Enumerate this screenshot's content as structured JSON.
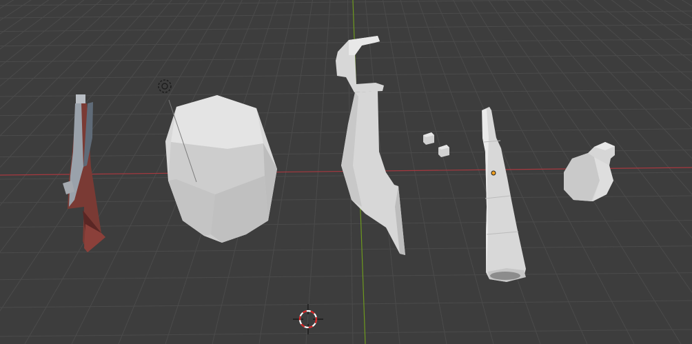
{
  "viewport": {
    "kind": "3d-viewport",
    "background": "#3d3d3d",
    "grid_color": "#4a4a4a",
    "x_axis_color": "#a8383f",
    "y_axis_color": "#6e9a1e"
  },
  "objects": [
    {
      "name": "flintlock-pistol",
      "material_color": "#7a3a34"
    },
    {
      "name": "barrel",
      "material_color": "#d4d4d4"
    },
    {
      "name": "cutlass",
      "material_color": "#d4d4d4"
    },
    {
      "name": "small-cubes",
      "material_color": "#d4d4d4"
    },
    {
      "name": "spyglass",
      "material_color": "#d4d4d4",
      "selected_origin_color": "#f0a020"
    },
    {
      "name": "bottle",
      "material_color": "#d4d4d4"
    }
  ],
  "gizmos": {
    "light_icon": "light-icon",
    "cursor_icon": "3d-cursor-icon",
    "cursor_colors": [
      "#ffffff",
      "#d42020"
    ]
  }
}
